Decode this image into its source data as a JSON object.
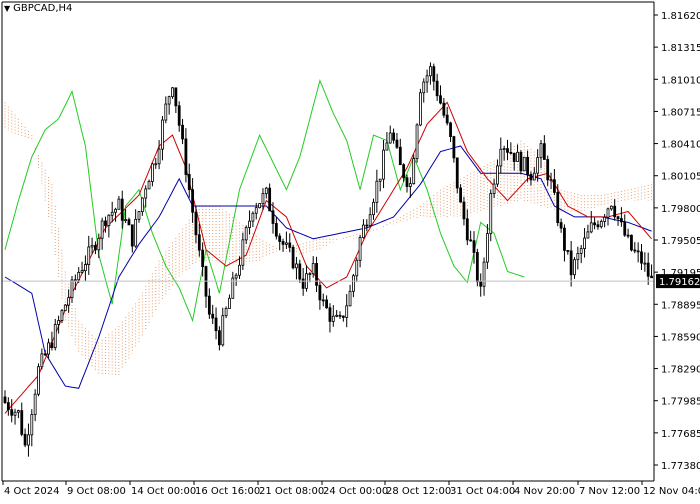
{
  "symbol_title": "GBPCAD,H4",
  "current_price": "1.79162",
  "colors": {
    "candle": "#000000",
    "tenkan": "#cc0000",
    "kijun": "#0000aa",
    "chikou": "#22cc22",
    "cloud": "#e8a070",
    "price_line": "#c0c0c0",
    "price_box_bg": "#000000",
    "price_box_text": "#ffffff"
  },
  "chart_data": {
    "type": "candlestick",
    "indicator": "Ichimoku Kinko Hyo",
    "ylim": [
      1.7733,
      1.8172
    ],
    "y_ticks": [
      "1.81620",
      "1.81315",
      "1.81010",
      "1.80715",
      "1.80410",
      "1.80105",
      "1.79800",
      "1.79505",
      "1.79195",
      "1.78895",
      "1.78590",
      "1.78290",
      "1.77985",
      "1.77685",
      "1.77380"
    ],
    "x_ticks": [
      "4 Oct 2024",
      "9 Oct 08:00",
      "14 Oct 00:00",
      "16 Oct 16:00",
      "21 Oct 08:00",
      "24 Oct 00:00",
      "28 Oct 12:00",
      "31 Oct 04:00",
      "4 Nov 20:00",
      "7 Nov 12:00",
      "12 Nov 04:00"
    ],
    "last_price": 1.79162,
    "close_anchors": [
      [
        0,
        1.7805
      ],
      [
        4,
        1.7795
      ],
      [
        6,
        1.7765
      ],
      [
        10,
        1.7835
      ],
      [
        14,
        1.7862
      ],
      [
        18,
        1.7895
      ],
      [
        22,
        1.7925
      ],
      [
        26,
        1.7945
      ],
      [
        30,
        1.7975
      ],
      [
        34,
        1.7985
      ],
      [
        38,
        1.7955
      ],
      [
        42,
        1.8005
      ],
      [
        45,
        1.803
      ],
      [
        48,
        1.8075
      ],
      [
        50,
        1.81
      ],
      [
        52,
        1.806
      ],
      [
        54,
        1.802
      ],
      [
        56,
        1.798
      ],
      [
        58,
        1.794
      ],
      [
        61,
        1.7885
      ],
      [
        64,
        1.7865
      ],
      [
        67,
        1.79
      ],
      [
        70,
        1.7935
      ],
      [
        74,
        1.7985
      ],
      [
        78,
        1.7995
      ],
      [
        82,
        1.7955
      ],
      [
        86,
        1.7935
      ],
      [
        89,
        1.7915
      ],
      [
        92,
        1.7925
      ],
      [
        95,
        1.7895
      ],
      [
        98,
        1.788
      ],
      [
        100,
        1.7878
      ],
      [
        103,
        1.7905
      ],
      [
        106,
        1.7955
      ],
      [
        109,
        1.7985
      ],
      [
        112,
        1.8015
      ],
      [
        115,
        1.8055
      ],
      [
        118,
        1.802
      ],
      [
        121,
        1.8005
      ],
      [
        124,
        1.8095
      ],
      [
        127,
        1.811
      ],
      [
        130,
        1.808
      ],
      [
        133,
        1.8045
      ],
      [
        136,
        1.7985
      ],
      [
        139,
        1.795
      ],
      [
        142,
        1.7905
      ],
      [
        145,
        1.7995
      ],
      [
        148,
        1.8045
      ],
      [
        151,
        1.8035
      ],
      [
        154,
        1.8025
      ],
      [
        157,
        1.8015
      ],
      [
        160,
        1.8035
      ],
      [
        163,
        1.8005
      ],
      [
        166,
        1.796
      ],
      [
        169,
        1.7925
      ],
      [
        172,
        1.7945
      ],
      [
        175,
        1.7965
      ],
      [
        178,
        1.7975
      ],
      [
        181,
        1.799
      ],
      [
        184,
        1.7965
      ],
      [
        187,
        1.7945
      ],
      [
        190,
        1.7935
      ],
      [
        193,
        1.7916
      ]
    ],
    "tenkan_anchors": [
      [
        0,
        1.7795
      ],
      [
        10,
        1.783
      ],
      [
        20,
        1.7905
      ],
      [
        30,
        1.7965
      ],
      [
        40,
        1.7995
      ],
      [
        46,
        1.804
      ],
      [
        50,
        1.805
      ],
      [
        54,
        1.802
      ],
      [
        60,
        1.7945
      ],
      [
        66,
        1.793
      ],
      [
        72,
        1.794
      ],
      [
        78,
        1.799
      ],
      [
        84,
        1.7975
      ],
      [
        90,
        1.793
      ],
      [
        96,
        1.791
      ],
      [
        102,
        1.792
      ],
      [
        108,
        1.796
      ],
      [
        114,
        1.799
      ],
      [
        120,
        1.802
      ],
      [
        126,
        1.806
      ],
      [
        132,
        1.808
      ],
      [
        138,
        1.8035
      ],
      [
        144,
        1.801
      ],
      [
        150,
        1.799
      ],
      [
        156,
        1.801
      ],
      [
        162,
        1.8015
      ],
      [
        168,
        1.7985
      ],
      [
        174,
        1.7975
      ],
      [
        180,
        1.7975
      ],
      [
        186,
        1.798
      ],
      [
        193,
        1.7955
      ]
    ],
    "kijun_anchors": [
      [
        0,
        1.792
      ],
      [
        8,
        1.7905
      ],
      [
        12,
        1.785
      ],
      [
        18,
        1.782
      ],
      [
        22,
        1.7818
      ],
      [
        28,
        1.7865
      ],
      [
        34,
        1.792
      ],
      [
        40,
        1.795
      ],
      [
        46,
        1.7975
      ],
      [
        52,
        1.801
      ],
      [
        56,
        1.7985
      ],
      [
        66,
        1.7985
      ],
      [
        78,
        1.7985
      ],
      [
        84,
        1.7965
      ],
      [
        92,
        1.7955
      ],
      [
        100,
        1.796
      ],
      [
        108,
        1.7965
      ],
      [
        116,
        1.7975
      ],
      [
        124,
        1.8005
      ],
      [
        130,
        1.8035
      ],
      [
        136,
        1.804
      ],
      [
        142,
        1.8015
      ],
      [
        154,
        1.8015
      ],
      [
        160,
        1.801
      ],
      [
        164,
        1.7985
      ],
      [
        170,
        1.7975
      ],
      [
        178,
        1.7975
      ],
      [
        186,
        1.797
      ],
      [
        193,
        1.7962
      ]
    ],
    "chikou_anchors": [
      [
        0,
        1.7945
      ],
      [
        4,
        1.799
      ],
      [
        8,
        1.803
      ],
      [
        12,
        1.8055
      ],
      [
        16,
        1.8065
      ],
      [
        20,
        1.809
      ],
      [
        24,
        1.804
      ],
      [
        28,
        1.794
      ],
      [
        32,
        1.7895
      ],
      [
        36,
        1.7985
      ],
      [
        40,
        1.8
      ],
      [
        44,
        1.796
      ],
      [
        48,
        1.793
      ],
      [
        52,
        1.791
      ],
      [
        56,
        1.788
      ],
      [
        60,
        1.7945
      ],
      [
        64,
        1.7905
      ],
      [
        70,
        1.8
      ],
      [
        76,
        1.805
      ],
      [
        80,
        1.8025
      ],
      [
        84,
        1.8
      ],
      [
        88,
        1.803
      ],
      [
        94,
        1.81
      ],
      [
        98,
        1.807
      ],
      [
        102,
        1.8045
      ],
      [
        106,
        1.8
      ],
      [
        110,
        1.805
      ],
      [
        114,
        1.8045
      ],
      [
        118,
        1.8
      ],
      [
        122,
        1.803
      ],
      [
        126,
        1.8
      ],
      [
        130,
        1.796
      ],
      [
        134,
        1.793
      ],
      [
        138,
        1.7915
      ],
      [
        142,
        1.797
      ],
      [
        146,
        1.796
      ],
      [
        150,
        1.7925
      ],
      [
        155,
        1.792
      ]
    ],
    "span_a_anchors": [
      [
        0,
        1.8055
      ],
      [
        8,
        1.8045
      ],
      [
        14,
        1.8005
      ],
      [
        18,
        1.7925
      ],
      [
        22,
        1.788
      ],
      [
        28,
        1.786
      ],
      [
        34,
        1.7875
      ],
      [
        40,
        1.79
      ],
      [
        46,
        1.7935
      ],
      [
        52,
        1.796
      ],
      [
        58,
        1.7985
      ],
      [
        64,
        1.7985
      ],
      [
        70,
        1.797
      ],
      [
        76,
        1.7955
      ],
      [
        82,
        1.7945
      ],
      [
        88,
        1.794
      ],
      [
        94,
        1.7945
      ],
      [
        100,
        1.7955
      ],
      [
        106,
        1.7955
      ],
      [
        112,
        1.7965
      ],
      [
        118,
        1.7975
      ],
      [
        124,
        1.7985
      ],
      [
        130,
        1.8
      ],
      [
        136,
        1.801
      ],
      [
        142,
        1.802
      ],
      [
        148,
        1.803
      ],
      [
        154,
        1.8045
      ],
      [
        160,
        1.803
      ],
      [
        166,
        1.8
      ],
      [
        172,
        1.7995
      ],
      [
        178,
        1.7995
      ],
      [
        186,
        1.8
      ],
      [
        193,
        1.8005
      ],
      [
        200,
        1.8
      ],
      [
        212,
        1.7985
      ]
    ],
    "span_b_anchors": [
      [
        0,
        1.808
      ],
      [
        8,
        1.805
      ],
      [
        14,
        1.796
      ],
      [
        18,
        1.788
      ],
      [
        22,
        1.785
      ],
      [
        28,
        1.783
      ],
      [
        34,
        1.783
      ],
      [
        40,
        1.786
      ],
      [
        46,
        1.7895
      ],
      [
        52,
        1.792
      ],
      [
        58,
        1.7935
      ],
      [
        64,
        1.7935
      ],
      [
        70,
        1.793
      ],
      [
        76,
        1.7935
      ],
      [
        82,
        1.7945
      ],
      [
        88,
        1.795
      ],
      [
        94,
        1.7955
      ],
      [
        100,
        1.7955
      ],
      [
        106,
        1.796
      ],
      [
        112,
        1.7965
      ],
      [
        118,
        1.797
      ],
      [
        124,
        1.7975
      ],
      [
        130,
        1.7975
      ],
      [
        136,
        1.7975
      ],
      [
        142,
        1.798
      ],
      [
        148,
        1.7985
      ],
      [
        154,
        1.799
      ],
      [
        160,
        1.7985
      ],
      [
        166,
        1.798
      ],
      [
        172,
        1.798
      ],
      [
        178,
        1.7985
      ],
      [
        186,
        1.799
      ],
      [
        193,
        1.799
      ],
      [
        200,
        1.799
      ],
      [
        212,
        1.799
      ]
    ]
  }
}
